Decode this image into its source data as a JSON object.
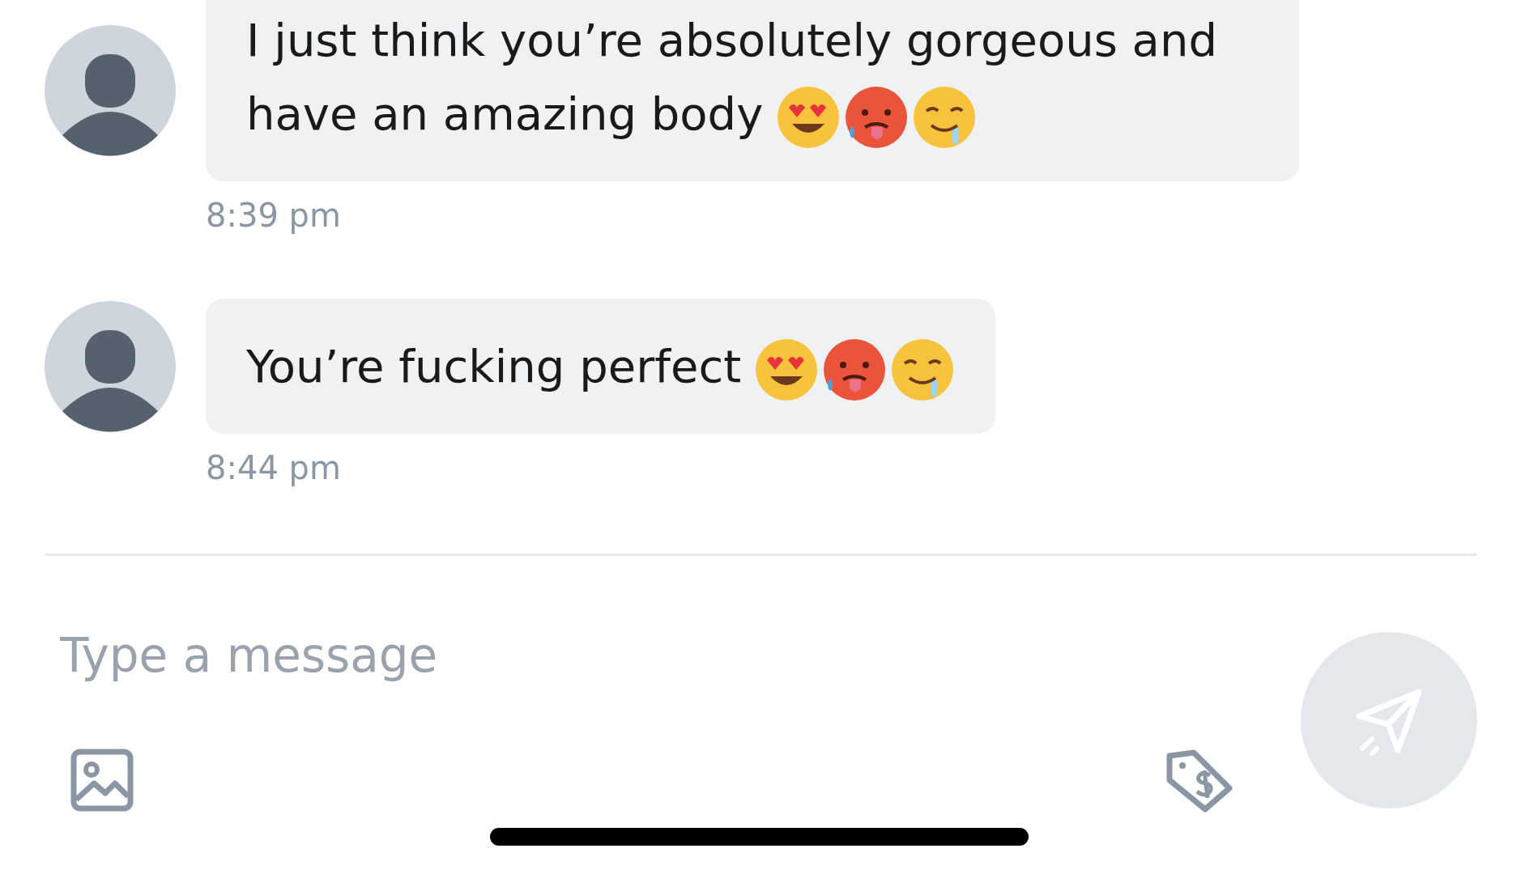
{
  "messages": [
    {
      "text": "I just think you’re absolutely gorgeous and have an amazing body",
      "time": "8:39 pm"
    },
    {
      "text": "You’re fucking perfect",
      "time": "8:44 pm"
    }
  ],
  "composer": {
    "placeholder": "Type a message"
  }
}
